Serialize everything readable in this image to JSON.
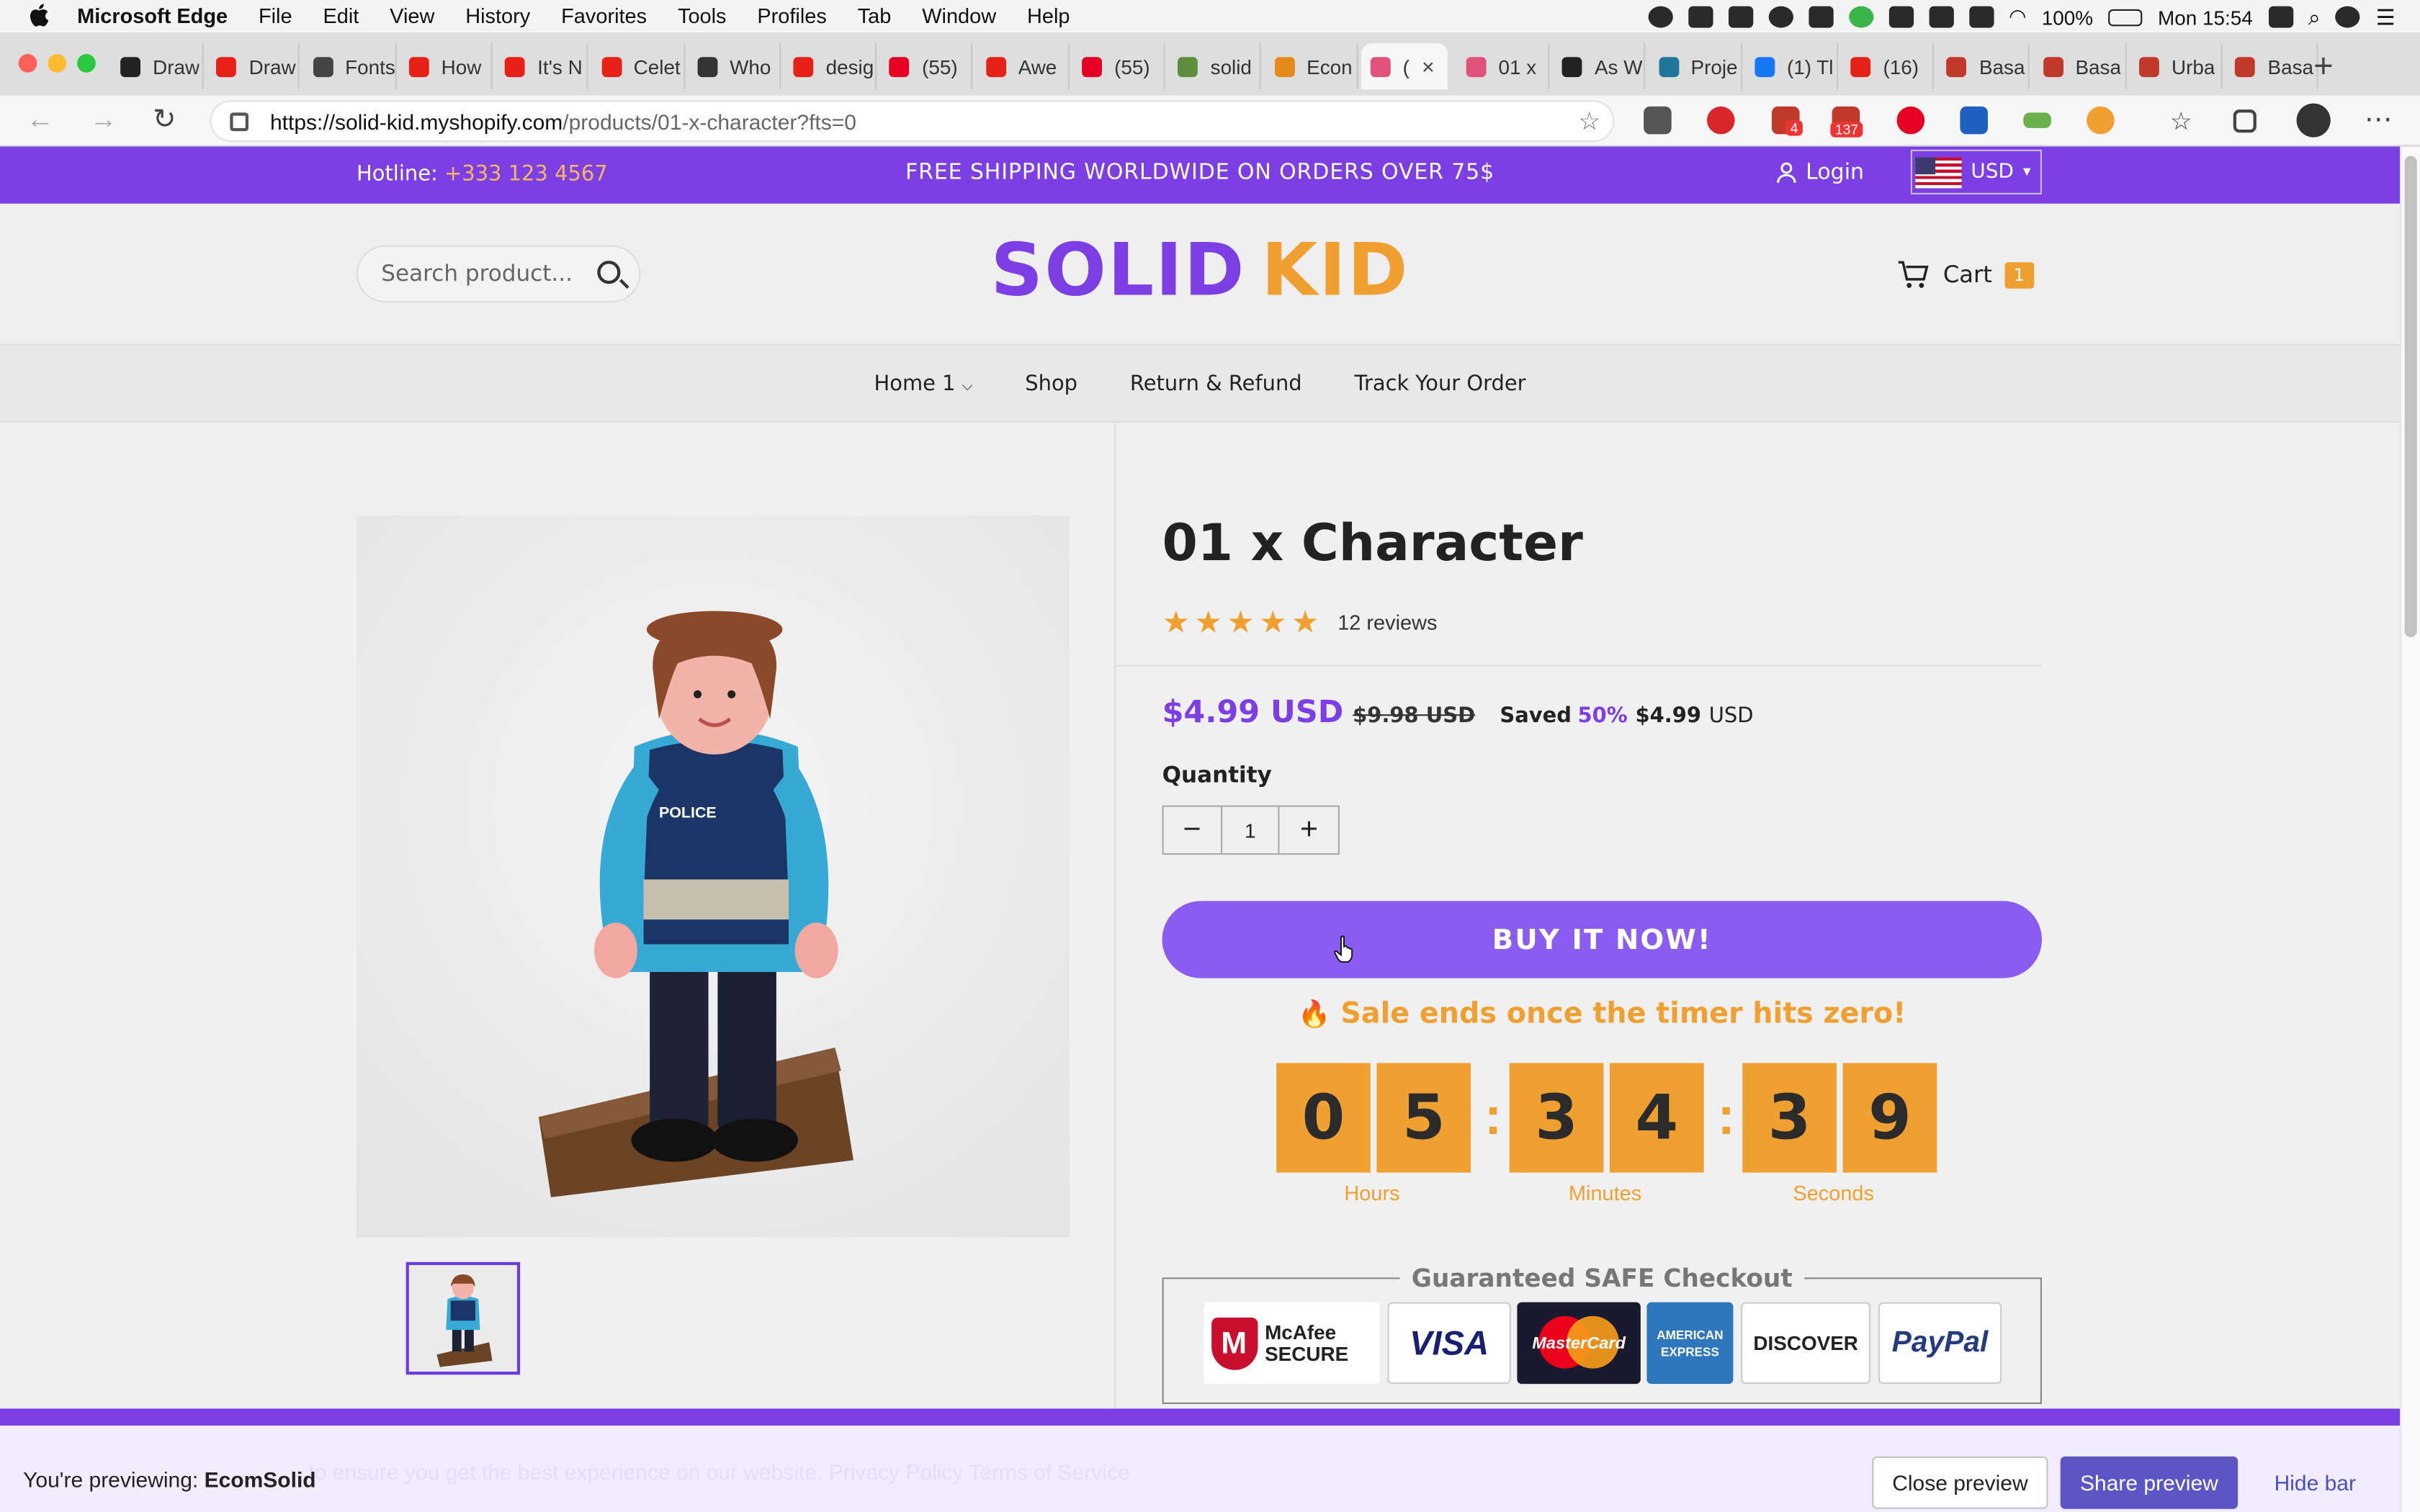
{
  "system_menubar": {
    "app_name": "Microsoft Edge",
    "menus": [
      "File",
      "Edit",
      "View",
      "History",
      "Favorites",
      "Tools",
      "Profiles",
      "Tab",
      "Window",
      "Help"
    ],
    "battery": "100%",
    "clock": "Mon 15:54"
  },
  "tabs": [
    {
      "title": "Draw",
      "favicon_color": "#222222"
    },
    {
      "title": "Draw",
      "favicon_color": "#e62117"
    },
    {
      "title": "Fonts",
      "favicon_color": "#444444"
    },
    {
      "title": "How",
      "favicon_color": "#e62117"
    },
    {
      "title": "It's N",
      "favicon_color": "#e62117"
    },
    {
      "title": "Celet",
      "favicon_color": "#e62117"
    },
    {
      "title": "Who",
      "favicon_color": "#333333"
    },
    {
      "title": "desig",
      "favicon_color": "#e62117"
    },
    {
      "title": "(55)",
      "favicon_color": "#e60023"
    },
    {
      "title": "Awe",
      "favicon_color": "#e62117"
    },
    {
      "title": "(55)",
      "favicon_color": "#e60023"
    },
    {
      "title": "solid",
      "favicon_color": "#5e8e3e"
    },
    {
      "title": "Econ",
      "favicon_color": "#e58a1c"
    },
    {
      "title": "(",
      "favicon_color": "#e0527a",
      "active": true
    },
    {
      "title": "01 x",
      "favicon_color": "#e0527a"
    },
    {
      "title": "As W",
      "favicon_color": "#222222"
    },
    {
      "title": "Proje",
      "favicon_color": "#21759b"
    },
    {
      "title": "(1) Tl",
      "favicon_color": "#1877f2"
    },
    {
      "title": "(16)",
      "favicon_color": "#e62117"
    },
    {
      "title": "Basa",
      "favicon_color": "#c0392b"
    },
    {
      "title": "Basa",
      "favicon_color": "#c0392b"
    },
    {
      "title": "Urba",
      "favicon_color": "#c0392b"
    },
    {
      "title": "Basa",
      "favicon_color": "#c0392b"
    }
  ],
  "address_bar": {
    "url_host": "https://solid-kid.myshopify.com",
    "url_path": "/products/01-x-character?fts=0"
  },
  "extension_badges": {
    "mail": "4",
    "calendar": "137"
  },
  "announcement": {
    "hotline_label": "Hotline:",
    "hotline_number": "+333 123 4567",
    "shipping": "FREE SHIPPING WORLDWIDE ON ORDERS OVER 75$",
    "login": "Login",
    "currency": "USD"
  },
  "header": {
    "search_placeholder": "Search product...",
    "logo_part1": "SOLID",
    "logo_part2": "KID",
    "cart_label": "Cart",
    "cart_count": "1"
  },
  "nav": [
    "Home 1",
    "Shop",
    "Return & Refund",
    "Track Your Order"
  ],
  "product": {
    "title": "01 x Character",
    "rating": 5,
    "reviews": "12 reviews",
    "price": "$4.99 USD",
    "compare_price": "$9.98 USD",
    "saved_label": "Saved",
    "saved_pct": "50%",
    "saved_amount": "$4.99",
    "saved_currency": "USD",
    "quantity_label": "Quantity",
    "quantity": "1",
    "buy_button": "BUY IT NOW!",
    "sale_text": "Sale ends once the timer hits zero!",
    "timer": {
      "hours": [
        "0",
        "5"
      ],
      "minutes": [
        "3",
        "4"
      ],
      "seconds": [
        "3",
        "9"
      ]
    },
    "timer_labels": {
      "hours": "Hours",
      "minutes": "Minutes",
      "seconds": "Seconds"
    },
    "safe_checkout": "Guaranteed SAFE Checkout",
    "badges": [
      "McAfee SECURE",
      "VISA",
      "MasterCard",
      "AMERICAN EXPRESS",
      "DISCOVER",
      "PayPal"
    ]
  },
  "preview_bar": {
    "text_prefix": "You're previewing:",
    "store": "EcomSolid",
    "behind_text": "to ensure you get the best experience on our website. Privacy Policy  Terms of Service",
    "close": "Close preview",
    "share": "Share preview",
    "hide": "Hide bar"
  },
  "colors": {
    "brand_purple": "#7b3fe4",
    "accent_orange": "#f0a030",
    "buy_button": "#8b5cf0"
  }
}
